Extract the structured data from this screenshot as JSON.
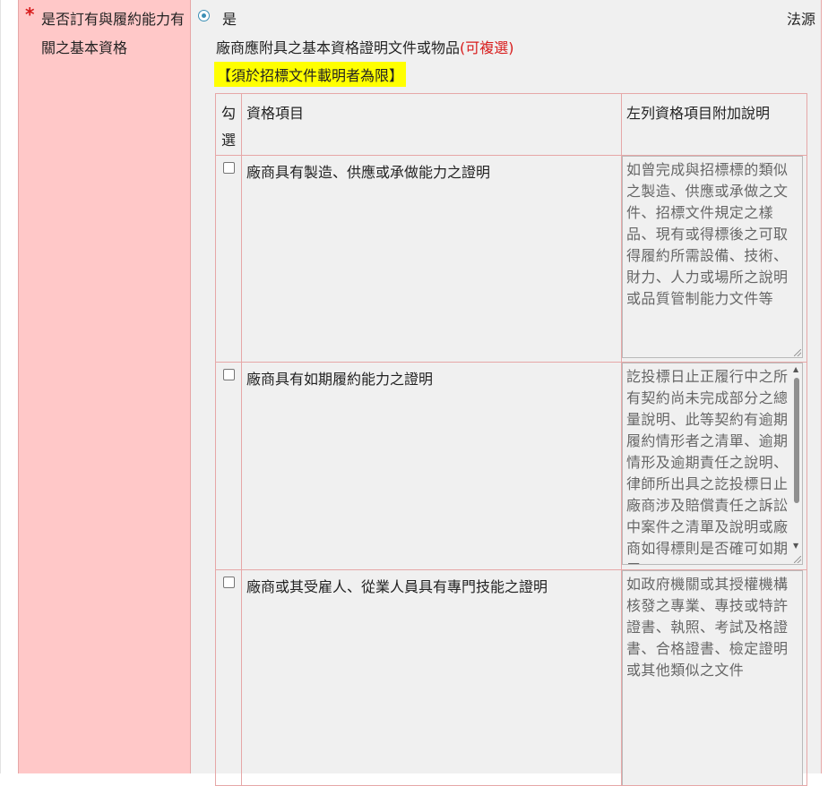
{
  "field": {
    "required_mark": "*",
    "label": "是否訂有與履約能力有關之基本資格"
  },
  "option": {
    "radio_label": "是",
    "selected": true
  },
  "source_label": "法源",
  "description": {
    "text": "廠商應附具之基本資格證明文件或物品",
    "hint": "(可複選)"
  },
  "notice": "【須於招標文件載明者為限】",
  "table": {
    "headers": {
      "check": "勾選",
      "item": "資格項目",
      "note": "左列資格項目附加說明"
    },
    "rows": [
      {
        "checked": false,
        "item": "廠商具有製造、供應或承做能力之證明",
        "note": "如曾完成與招標標的類似之製造、供應或承做之文件、招標文件規定之樣品、現有或得標後之可取得履約所需設備、技術、財力、人力或場所之說明或品質管制能力文件等"
      },
      {
        "checked": false,
        "item": "廠商具有如期履約能力之證明",
        "note": "訖投標日止正履行中之所有契約尚未完成部分之總量說明、此等契約有逾期履約情形者之清單、逾期情形及逾期責任之說明、律師所出具之訖投標日止廠商涉及賠償責任之訴訟中案件之清單及說明或廠商如得標則是否確可如期履"
      },
      {
        "checked": false,
        "item": "廠商或其受雇人、從業人員具有專門技能之證明",
        "note": "如政府機關或其授權機構核發之專業、專技或特許證書、執照、考試及格證書、合格證書、檢定證明或其他類似之文件"
      }
    ]
  },
  "colors": {
    "label_bg": "#ffc8c8",
    "content_bg": "#f0f0f0",
    "border": "#e6a7a7",
    "required": "#d81b1b",
    "highlight": "#ffff00",
    "radio": "#3c8fb5"
  }
}
